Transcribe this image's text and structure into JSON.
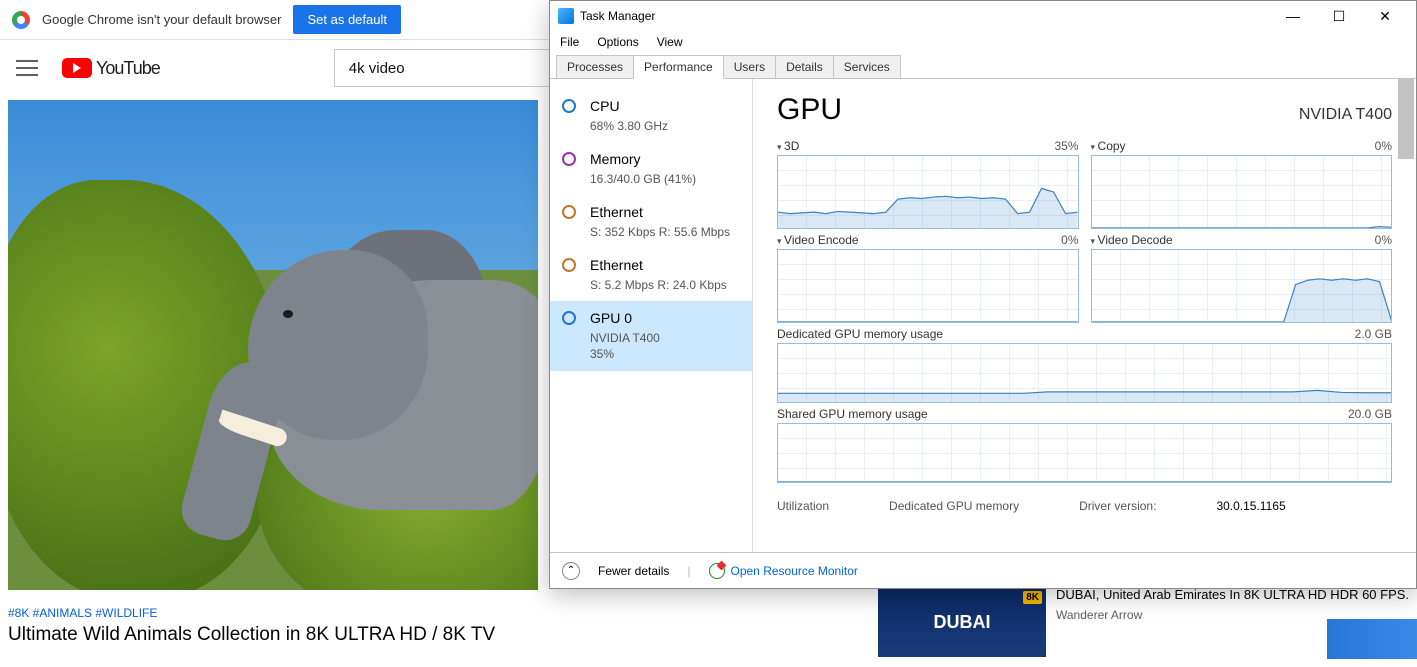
{
  "chrome": {
    "notice": "Google Chrome isn't your default browser",
    "set_default": "Set as default",
    "logo_text": "YouTube",
    "search_value": "4k video",
    "video_tags": "#8K #ANIMALS #WILDLIFE",
    "video_title": "Ultimate Wild Animals Collection in 8K ULTRA HD / 8K TV",
    "related": {
      "thumb_badge": "8K",
      "thumb_text": "DUBAI",
      "title": "DUBAI, United Arab Emirates In 8K ULTRA HD HDR 60 FPS.",
      "channel": "Wanderer Arrow"
    }
  },
  "tm": {
    "title": "Task Manager",
    "menu": {
      "file": "File",
      "options": "Options",
      "view": "View"
    },
    "tabs": {
      "processes": "Processes",
      "performance": "Performance",
      "users": "Users",
      "details": "Details",
      "services": "Services"
    },
    "sidebar": {
      "cpu": {
        "title": "CPU",
        "sub": "68%  3.80 GHz",
        "ring": "#1f77d0"
      },
      "memory": {
        "title": "Memory",
        "sub": "16.3/40.0 GB (41%)",
        "ring": "#9b2fae"
      },
      "eth1": {
        "title": "Ethernet",
        "sub": "S: 352 Kbps R: 55.6 Mbps",
        "ring": "#c7742c"
      },
      "eth2": {
        "title": "Ethernet",
        "sub": "S: 5.2 Mbps R: 24.0 Kbps",
        "ring": "#c7742c"
      },
      "gpu": {
        "title": "GPU 0",
        "sub1": "NVIDIA T400",
        "sub2": "35%",
        "ring": "#1f77d0"
      }
    },
    "detail": {
      "header": "GPU",
      "model": "NVIDIA T400",
      "panels": {
        "p3d": {
          "label": "3D",
          "value": "35%"
        },
        "copy": {
          "label": "Copy",
          "value": "0%"
        },
        "venc": {
          "label": "Video Encode",
          "value": "0%"
        },
        "vdec": {
          "label": "Video Decode",
          "value": "0%"
        },
        "dmem": {
          "label": "Dedicated GPU memory usage",
          "value": "2.0 GB"
        },
        "smem": {
          "label": "Shared GPU memory usage",
          "value": "20.0 GB"
        }
      },
      "stats": {
        "util_k": "Utilization",
        "dmem_k": "Dedicated GPU memory",
        "drv_k": "Driver version:",
        "drv_v": "30.0.15.1165"
      }
    },
    "footer": {
      "fewer": "Fewer details",
      "monitor": "Open Resource Monitor"
    }
  },
  "chart_data": [
    {
      "type": "area",
      "title": "3D",
      "ylim": [
        0,
        100
      ],
      "values": [
        22,
        20,
        21,
        22,
        20,
        23,
        22,
        21,
        20,
        22,
        40,
        42,
        41,
        43,
        44,
        42,
        43,
        41,
        42,
        40,
        20,
        22,
        55,
        50,
        20,
        22
      ]
    },
    {
      "type": "area",
      "title": "Copy",
      "ylim": [
        0,
        100
      ],
      "values": [
        0,
        0,
        0,
        0,
        0,
        0,
        0,
        0,
        0,
        0,
        0,
        0,
        0,
        0,
        0,
        0,
        0,
        0,
        0,
        0,
        0,
        0,
        0,
        0,
        2,
        1
      ]
    },
    {
      "type": "area",
      "title": "Video Encode",
      "ylim": [
        0,
        100
      ],
      "values": [
        0,
        0,
        0,
        0,
        0,
        0,
        0,
        0,
        0,
        0,
        0,
        0,
        0,
        0,
        0,
        0,
        0,
        0,
        0,
        0,
        0,
        0,
        0,
        0,
        0,
        0
      ]
    },
    {
      "type": "area",
      "title": "Video Decode",
      "ylim": [
        0,
        100
      ],
      "values": [
        0,
        0,
        0,
        0,
        0,
        0,
        0,
        0,
        0,
        0,
        0,
        0,
        0,
        0,
        0,
        0,
        0,
        52,
        58,
        60,
        58,
        60,
        58,
        60,
        56,
        2
      ]
    },
    {
      "type": "area",
      "title": "Dedicated GPU memory usage",
      "ylim": [
        0,
        2.0
      ],
      "unit": "GB",
      "values": [
        0.3,
        0.3,
        0.3,
        0.3,
        0.3,
        0.3,
        0.3,
        0.3,
        0.3,
        0.3,
        0.3,
        0.35,
        0.35,
        0.35,
        0.35,
        0.35,
        0.35,
        0.35,
        0.35,
        0.35,
        0.35,
        0.35,
        0.4,
        0.33,
        0.32,
        0.32
      ]
    },
    {
      "type": "area",
      "title": "Shared GPU memory usage",
      "ylim": [
        0,
        20.0
      ],
      "unit": "GB",
      "values": [
        0,
        0,
        0,
        0,
        0,
        0,
        0,
        0,
        0,
        0,
        0,
        0,
        0,
        0,
        0,
        0,
        0,
        0,
        0,
        0,
        0,
        0,
        0,
        0,
        0,
        0
      ]
    }
  ]
}
